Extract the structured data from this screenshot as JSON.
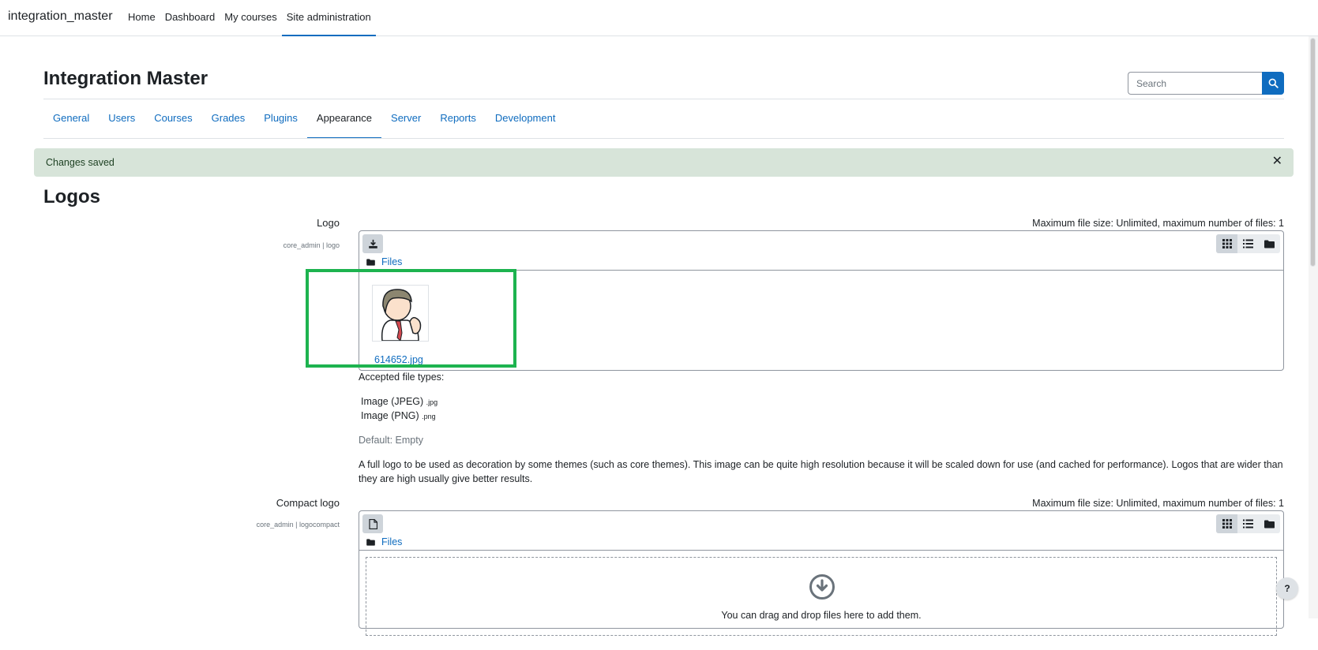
{
  "navbar": {
    "brand": "integration_master",
    "items": [
      {
        "label": "Home"
      },
      {
        "label": "Dashboard"
      },
      {
        "label": "My courses"
      },
      {
        "label": "Site administration"
      }
    ]
  },
  "header": {
    "title": "Integration Master",
    "search_placeholder": "Search"
  },
  "tabs": [
    {
      "label": "General"
    },
    {
      "label": "Users"
    },
    {
      "label": "Courses"
    },
    {
      "label": "Grades"
    },
    {
      "label": "Plugins"
    },
    {
      "label": "Appearance"
    },
    {
      "label": "Server"
    },
    {
      "label": "Reports"
    },
    {
      "label": "Development"
    }
  ],
  "alert": {
    "message": "Changes saved",
    "close": "✕"
  },
  "section_title": "Logos",
  "logo_setting": {
    "label": "Logo",
    "key": "core_admin | logo",
    "max_size": "Maximum file size: Unlimited, maximum number of files: 1",
    "path_label": "Files",
    "file_name": "614652.jpg",
    "accepted_label": "Accepted file types:",
    "types": [
      {
        "name": "Image (JPEG)",
        "ext": ".jpg"
      },
      {
        "name": "Image (PNG)",
        "ext": ".png"
      }
    ],
    "default": "Default: Empty",
    "description": "A full logo to be used as decoration by some themes (such as core themes). This image can be quite high resolution because it will be scaled down for use (and cached for performance). Logos that are wider than they are high usually give better results."
  },
  "compact_logo_setting": {
    "label": "Compact logo",
    "key": "core_admin | logocompact",
    "max_size": "Maximum file size: Unlimited, maximum number of files: 1",
    "path_label": "Files",
    "drop_text": "You can drag and drop files here to add them."
  },
  "help_button": "?",
  "colors": {
    "accent": "#0f6cbf",
    "alert_bg": "#d7e4d9",
    "highlight": "#1db34f"
  }
}
